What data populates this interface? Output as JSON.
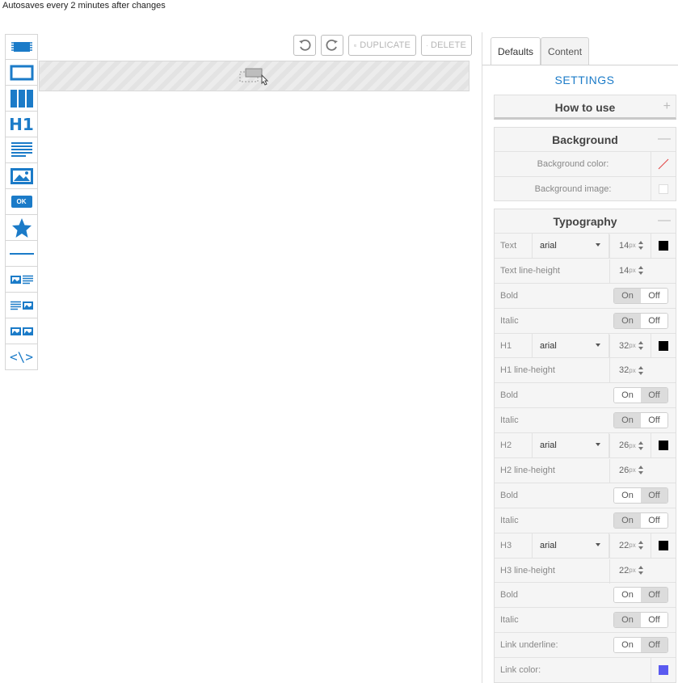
{
  "autosave_text": "Autosaves every 2 minutes after changes",
  "toolbar": {
    "items": [
      {
        "name": "block-tool-icon"
      },
      {
        "name": "box-tool-icon"
      },
      {
        "name": "columns-tool-icon"
      },
      {
        "name": "heading-tool-icon",
        "text": "H1"
      },
      {
        "name": "text-tool-icon"
      },
      {
        "name": "image-tool-icon"
      },
      {
        "name": "button-tool-icon",
        "text": "OK"
      },
      {
        "name": "star-tool-icon"
      },
      {
        "name": "divider-tool-icon"
      },
      {
        "name": "image-text-tool-icon"
      },
      {
        "name": "text-image-tool-icon"
      },
      {
        "name": "two-images-tool-icon"
      },
      {
        "name": "code-tool-icon",
        "text": "<\\>"
      }
    ]
  },
  "actions": {
    "duplicate_label": "DUPLICATE",
    "delete_label": "DELETE"
  },
  "tabs": {
    "defaults": "Defaults",
    "content": "Content"
  },
  "settings_title": "SETTINGS",
  "how_to_use": {
    "title": "How to use",
    "toggle": "+"
  },
  "background": {
    "title": "Background",
    "toggle": "—",
    "color_label": "Background color:",
    "image_label": "Background image:"
  },
  "typography": {
    "title": "Typography",
    "toggle": "—",
    "text_label": "Text",
    "text_font": "arial",
    "text_size": "14",
    "text_color": "#000000",
    "text_lh_label": "Text line-height",
    "text_lh": "14",
    "bold_label": "Bold",
    "italic_label": "Italic",
    "on": "On",
    "off": "Off",
    "h1_label": "H1",
    "h1_font": "arial",
    "h1_size": "32",
    "h1_color": "#000000",
    "h1_lh_label": "H1 line-height",
    "h1_lh": "32",
    "h2_label": "H2",
    "h2_font": "arial",
    "h2_size": "26",
    "h2_color": "#000000",
    "h2_lh_label": "H2 line-height",
    "h2_lh": "26",
    "h3_label": "H3",
    "h3_font": "arial",
    "h3_size": "22",
    "h3_color": "#000000",
    "h3_lh_label": "H3 line-height",
    "h3_lh": "22",
    "px_unit": "px",
    "link_underline_label": "Link underline:",
    "link_color_label": "Link color:",
    "link_color": "#5a5af0"
  },
  "colors": {
    "accent": "#1b7bc8"
  }
}
